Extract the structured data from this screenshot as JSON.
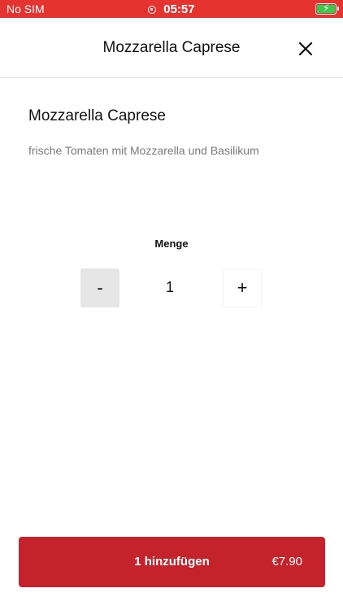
{
  "status_bar": {
    "carrier": "No SIM",
    "time": "05:57",
    "background_color": "#e5332f",
    "battery_color": "#42c64a",
    "battery_icon": "battery-charging-icon",
    "recording_icon": "location-indicator-icon"
  },
  "header": {
    "title": "Mozzarella Caprese",
    "close_icon": "close-icon"
  },
  "product": {
    "name": "Mozzarella Caprese",
    "description": "frische Tomaten mit Mozzarella und Basilikum"
  },
  "quantity": {
    "label": "Menge",
    "minus_label": "-",
    "plus_label": "+",
    "value": "1"
  },
  "add_button": {
    "label": "1 hinzufügen",
    "price": "€7.90",
    "color": "#c5232b"
  }
}
